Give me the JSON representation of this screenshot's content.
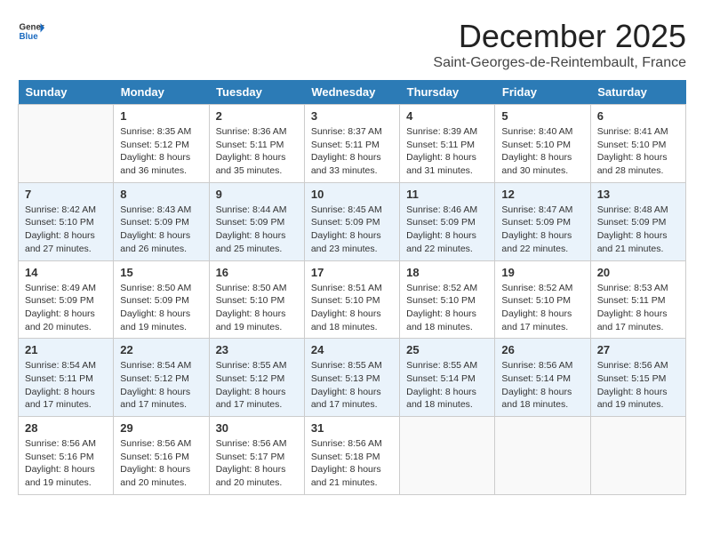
{
  "logo": {
    "line1": "General",
    "line2": "Blue"
  },
  "title": "December 2025",
  "location": "Saint-Georges-de-Reintembault, France",
  "weekdays": [
    "Sunday",
    "Monday",
    "Tuesday",
    "Wednesday",
    "Thursday",
    "Friday",
    "Saturday"
  ],
  "weeks": [
    [
      {
        "day": "",
        "sunrise": "",
        "sunset": "",
        "daylight": ""
      },
      {
        "day": "1",
        "sunrise": "Sunrise: 8:35 AM",
        "sunset": "Sunset: 5:12 PM",
        "daylight": "Daylight: 8 hours and 36 minutes."
      },
      {
        "day": "2",
        "sunrise": "Sunrise: 8:36 AM",
        "sunset": "Sunset: 5:11 PM",
        "daylight": "Daylight: 8 hours and 35 minutes."
      },
      {
        "day": "3",
        "sunrise": "Sunrise: 8:37 AM",
        "sunset": "Sunset: 5:11 PM",
        "daylight": "Daylight: 8 hours and 33 minutes."
      },
      {
        "day": "4",
        "sunrise": "Sunrise: 8:39 AM",
        "sunset": "Sunset: 5:11 PM",
        "daylight": "Daylight: 8 hours and 31 minutes."
      },
      {
        "day": "5",
        "sunrise": "Sunrise: 8:40 AM",
        "sunset": "Sunset: 5:10 PM",
        "daylight": "Daylight: 8 hours and 30 minutes."
      },
      {
        "day": "6",
        "sunrise": "Sunrise: 8:41 AM",
        "sunset": "Sunset: 5:10 PM",
        "daylight": "Daylight: 8 hours and 28 minutes."
      }
    ],
    [
      {
        "day": "7",
        "sunrise": "Sunrise: 8:42 AM",
        "sunset": "Sunset: 5:10 PM",
        "daylight": "Daylight: 8 hours and 27 minutes."
      },
      {
        "day": "8",
        "sunrise": "Sunrise: 8:43 AM",
        "sunset": "Sunset: 5:09 PM",
        "daylight": "Daylight: 8 hours and 26 minutes."
      },
      {
        "day": "9",
        "sunrise": "Sunrise: 8:44 AM",
        "sunset": "Sunset: 5:09 PM",
        "daylight": "Daylight: 8 hours and 25 minutes."
      },
      {
        "day": "10",
        "sunrise": "Sunrise: 8:45 AM",
        "sunset": "Sunset: 5:09 PM",
        "daylight": "Daylight: 8 hours and 23 minutes."
      },
      {
        "day": "11",
        "sunrise": "Sunrise: 8:46 AM",
        "sunset": "Sunset: 5:09 PM",
        "daylight": "Daylight: 8 hours and 22 minutes."
      },
      {
        "day": "12",
        "sunrise": "Sunrise: 8:47 AM",
        "sunset": "Sunset: 5:09 PM",
        "daylight": "Daylight: 8 hours and 22 minutes."
      },
      {
        "day": "13",
        "sunrise": "Sunrise: 8:48 AM",
        "sunset": "Sunset: 5:09 PM",
        "daylight": "Daylight: 8 hours and 21 minutes."
      }
    ],
    [
      {
        "day": "14",
        "sunrise": "Sunrise: 8:49 AM",
        "sunset": "Sunset: 5:09 PM",
        "daylight": "Daylight: 8 hours and 20 minutes."
      },
      {
        "day": "15",
        "sunrise": "Sunrise: 8:50 AM",
        "sunset": "Sunset: 5:09 PM",
        "daylight": "Daylight: 8 hours and 19 minutes."
      },
      {
        "day": "16",
        "sunrise": "Sunrise: 8:50 AM",
        "sunset": "Sunset: 5:10 PM",
        "daylight": "Daylight: 8 hours and 19 minutes."
      },
      {
        "day": "17",
        "sunrise": "Sunrise: 8:51 AM",
        "sunset": "Sunset: 5:10 PM",
        "daylight": "Daylight: 8 hours and 18 minutes."
      },
      {
        "day": "18",
        "sunrise": "Sunrise: 8:52 AM",
        "sunset": "Sunset: 5:10 PM",
        "daylight": "Daylight: 8 hours and 18 minutes."
      },
      {
        "day": "19",
        "sunrise": "Sunrise: 8:52 AM",
        "sunset": "Sunset: 5:10 PM",
        "daylight": "Daylight: 8 hours and 17 minutes."
      },
      {
        "day": "20",
        "sunrise": "Sunrise: 8:53 AM",
        "sunset": "Sunset: 5:11 PM",
        "daylight": "Daylight: 8 hours and 17 minutes."
      }
    ],
    [
      {
        "day": "21",
        "sunrise": "Sunrise: 8:54 AM",
        "sunset": "Sunset: 5:11 PM",
        "daylight": "Daylight: 8 hours and 17 minutes."
      },
      {
        "day": "22",
        "sunrise": "Sunrise: 8:54 AM",
        "sunset": "Sunset: 5:12 PM",
        "daylight": "Daylight: 8 hours and 17 minutes."
      },
      {
        "day": "23",
        "sunrise": "Sunrise: 8:55 AM",
        "sunset": "Sunset: 5:12 PM",
        "daylight": "Daylight: 8 hours and 17 minutes."
      },
      {
        "day": "24",
        "sunrise": "Sunrise: 8:55 AM",
        "sunset": "Sunset: 5:13 PM",
        "daylight": "Daylight: 8 hours and 17 minutes."
      },
      {
        "day": "25",
        "sunrise": "Sunrise: 8:55 AM",
        "sunset": "Sunset: 5:14 PM",
        "daylight": "Daylight: 8 hours and 18 minutes."
      },
      {
        "day": "26",
        "sunrise": "Sunrise: 8:56 AM",
        "sunset": "Sunset: 5:14 PM",
        "daylight": "Daylight: 8 hours and 18 minutes."
      },
      {
        "day": "27",
        "sunrise": "Sunrise: 8:56 AM",
        "sunset": "Sunset: 5:15 PM",
        "daylight": "Daylight: 8 hours and 19 minutes."
      }
    ],
    [
      {
        "day": "28",
        "sunrise": "Sunrise: 8:56 AM",
        "sunset": "Sunset: 5:16 PM",
        "daylight": "Daylight: 8 hours and 19 minutes."
      },
      {
        "day": "29",
        "sunrise": "Sunrise: 8:56 AM",
        "sunset": "Sunset: 5:16 PM",
        "daylight": "Daylight: 8 hours and 20 minutes."
      },
      {
        "day": "30",
        "sunrise": "Sunrise: 8:56 AM",
        "sunset": "Sunset: 5:17 PM",
        "daylight": "Daylight: 8 hours and 20 minutes."
      },
      {
        "day": "31",
        "sunrise": "Sunrise: 8:56 AM",
        "sunset": "Sunset: 5:18 PM",
        "daylight": "Daylight: 8 hours and 21 minutes."
      },
      {
        "day": "",
        "sunrise": "",
        "sunset": "",
        "daylight": ""
      },
      {
        "day": "",
        "sunrise": "",
        "sunset": "",
        "daylight": ""
      },
      {
        "day": "",
        "sunrise": "",
        "sunset": "",
        "daylight": ""
      }
    ]
  ]
}
